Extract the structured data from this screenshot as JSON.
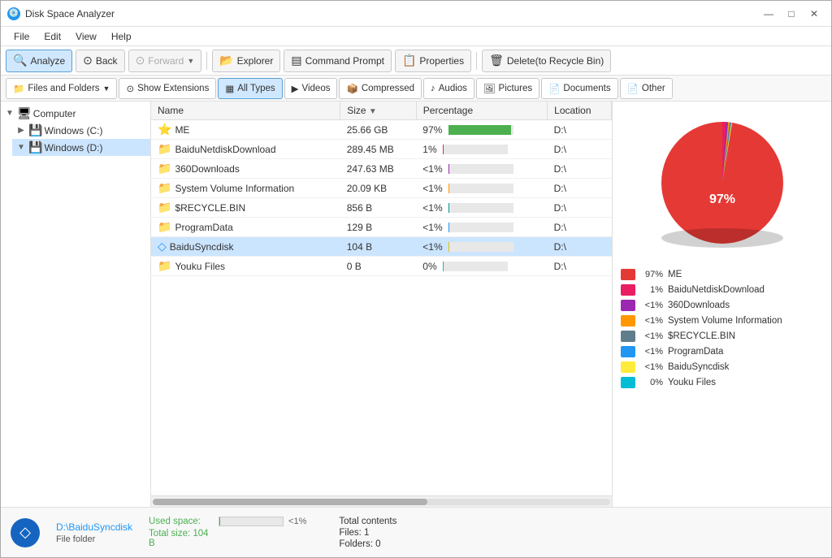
{
  "window": {
    "title": "Disk Space Analyzer",
    "icon": "💿"
  },
  "titlebar": {
    "minimize": "—",
    "maximize": "□",
    "close": "✕"
  },
  "menubar": {
    "items": [
      "File",
      "Edit",
      "View",
      "Help"
    ]
  },
  "toolbar": {
    "analyze": "Analyze",
    "back": "Back",
    "forward": "Forward",
    "explorer": "Explorer",
    "command_prompt": "Command Prompt",
    "properties": "Properties",
    "delete": "Delete(to Recycle Bin)"
  },
  "filter_tabs": {
    "files_folders": "Files and Folders",
    "show_extensions": "Show Extensions",
    "all_types": "All Types",
    "videos": "Videos",
    "compressed": "Compressed",
    "audios": "Audios",
    "pictures": "Pictures",
    "documents": "Documents",
    "other": "Other"
  },
  "tree": {
    "computer": "Computer",
    "windows_c": "Windows (C:)",
    "windows_d": "Windows (D:)"
  },
  "table": {
    "headers": [
      "Name",
      "Size",
      "Percentage",
      "Location"
    ],
    "rows": [
      {
        "icon": "⭐",
        "name": "ME",
        "size": "25.66 GB",
        "pct": 97,
        "pct_label": "97%",
        "location": "D:\\",
        "bar_color": "green",
        "icon_color": "#FFD700"
      },
      {
        "icon": "📁",
        "name": "BaiduNetdiskDownload",
        "size": "289.45 MB",
        "pct": 1,
        "pct_label": "1%",
        "location": "D:\\",
        "bar_color": "pink"
      },
      {
        "icon": "📁",
        "name": "360Downloads",
        "size": "247.63 MB",
        "pct": 1,
        "pct_label": "<1%",
        "location": "D:\\",
        "bar_color": "purple"
      },
      {
        "icon": "📁",
        "name": "System Volume Information",
        "size": "20.09 KB",
        "pct": 1,
        "pct_label": "<1%",
        "location": "D:\\",
        "bar_color": "orange"
      },
      {
        "icon": "📁",
        "name": "$RECYCLE.BIN",
        "size": "856 B",
        "pct": 1,
        "pct_label": "<1%",
        "location": "D:\\",
        "bar_color": "teal"
      },
      {
        "icon": "📁",
        "name": "ProgramData",
        "size": "129 B",
        "pct": 1,
        "pct_label": "<1%",
        "location": "D:\\",
        "bar_color": "blue"
      },
      {
        "icon": "◇",
        "name": "BaiduSyncdisk",
        "size": "104 B",
        "pct": 1,
        "pct_label": "<1%",
        "location": "D:\\",
        "bar_color": "yellow",
        "selected": true
      },
      {
        "icon": "📁",
        "name": "Youku Files",
        "size": "0 B",
        "pct": 0,
        "pct_label": "0%",
        "location": "D:\\",
        "bar_color": "cyan"
      }
    ]
  },
  "legend": [
    {
      "color": "#e53935",
      "pct": "97%",
      "label": "ME"
    },
    {
      "color": "#e91e63",
      "pct": "1%",
      "label": "BaiduNetdiskDownload"
    },
    {
      "color": "#9c27b0",
      "pct": "<1%",
      "label": "360Downloads"
    },
    {
      "color": "#ff9800",
      "pct": "<1%",
      "label": "System Volume Information"
    },
    {
      "color": "#607d8b",
      "pct": "<1%",
      "label": "$RECYCLE.BIN"
    },
    {
      "color": "#2196f3",
      "pct": "<1%",
      "label": "ProgramData"
    },
    {
      "color": "#ffeb3b",
      "pct": "<1%",
      "label": "BaiduSyncdisk"
    },
    {
      "color": "#00bcd4",
      "pct": "0%",
      "label": "Youku Files"
    }
  ],
  "status": {
    "path": "D:\\BaiduSyncdisk",
    "type": "File folder",
    "used_label": "Used space:",
    "used_pct": "<1%",
    "total_label": "Total size: 104 B",
    "total_contents_label": "Total contents",
    "files": "Files: 1",
    "folders": "Folders: 0"
  }
}
